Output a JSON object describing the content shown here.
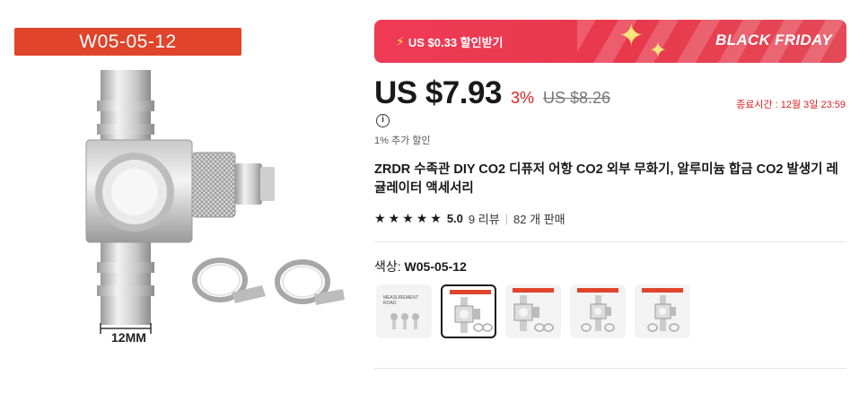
{
  "gallery": {
    "model_banner": "W05-05-12",
    "dimension_label": "12MM"
  },
  "promo": {
    "coupon_text": "US $0.33 할인받기",
    "event_label": "BLACK FRIDAY",
    "accent_color": "#e8394c"
  },
  "pricing": {
    "price": "US $7.93",
    "discount": "3%",
    "original": "US $8.26",
    "deadline": "종료시간 : 12월 3일 23:59",
    "extra_discount": "1% 추가 할인"
  },
  "product": {
    "title": "ZRDR 수족관 DIY CO2 디퓨저 어항 CO2 외부 무화기, 알루미늄 합금 CO2 발생기 레귤레이터 액세서리",
    "rating": "5.0",
    "star_count": 5,
    "reviews": "9 리뷰",
    "sold": "82 개 판매"
  },
  "variant": {
    "label": "색상:",
    "selected": "W05-05-12",
    "swatches": [
      {
        "name": "measurement",
        "text": "MEASUREMENT ROAD",
        "active": false
      },
      {
        "name": "w05-05-12",
        "text": "W05-05-12",
        "active": true
      },
      {
        "name": "variant-3",
        "text": "",
        "active": false
      },
      {
        "name": "variant-4",
        "text": "",
        "active": false
      },
      {
        "name": "variant-5",
        "text": "",
        "active": false
      }
    ]
  },
  "icons": {
    "bolt": "lightning-icon",
    "info": "info-icon",
    "star": "star-icon"
  }
}
